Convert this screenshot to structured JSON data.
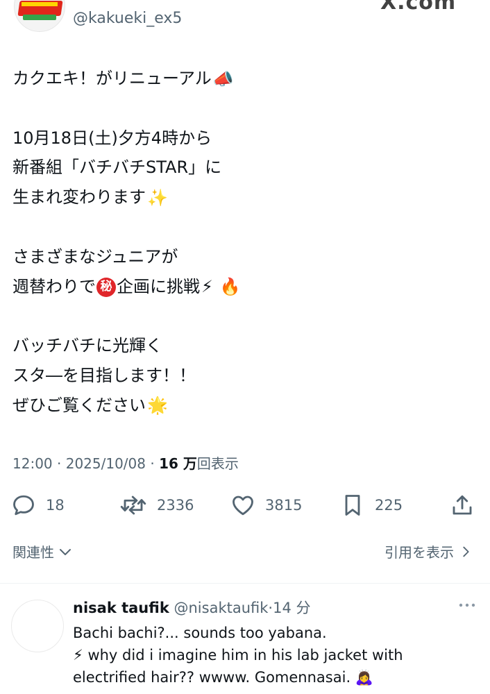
{
  "header": {
    "handle": "@kakueki_ex5",
    "watermark": "X.com"
  },
  "post": {
    "lines": [
      "カクエキ！がリニューアル",
      "",
      "10月18日(土)夕方4時から",
      "新番組「バチバチSTAR」に",
      "生まれ変わります",
      "",
      "さまざまなジュニアが",
      "週替わりで",
      "企画に挑戦",
      "",
      "バッチバチに光輝く",
      "スタ―を目指します！！",
      "ぜひご覧ください"
    ],
    "secret_mark": "秘",
    "emoji": {
      "megaphone": "📣",
      "sparkles": "✨",
      "lightning": "⚡",
      "fire": "🔥",
      "glowing_star": "🌟"
    },
    "time": "12:00",
    "date": "2025/10/08",
    "views_count": "16 万",
    "views_label": "回表示"
  },
  "actions": {
    "replies": "18",
    "reposts": "2336",
    "likes": "3815",
    "bookmarks": "225"
  },
  "related": {
    "relevance_label": "関連性",
    "quotes_label": "引用を表示"
  },
  "reply": {
    "name": "nisak taufik",
    "handle": "@nisaktaufik",
    "time": "14 分",
    "line1": "Bachi bachi?... sounds too yabana.",
    "line2_emoji": "⚡",
    "line2": "why did i imagine him in his lab jacket with",
    "line3": "electrified hair?? wwww. Gomennasai.",
    "line3_emoji": "🙇‍♀️"
  },
  "colors": {
    "text": "#0f1419",
    "secondary": "#536471",
    "divider": "#eff3f4"
  }
}
